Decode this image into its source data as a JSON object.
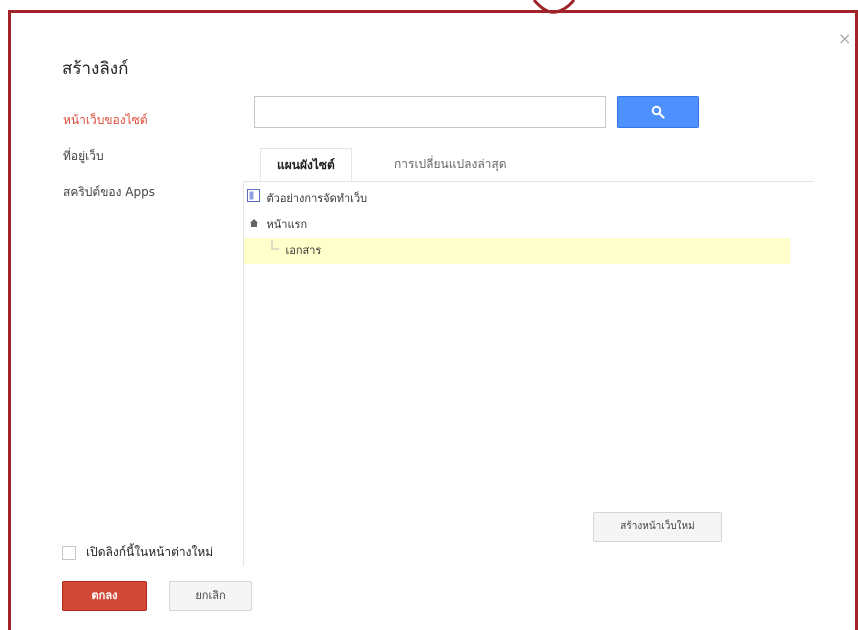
{
  "dialog": {
    "title": "สร้างลิงก์",
    "close_glyph": "×"
  },
  "sidebar": {
    "items": [
      {
        "label": "หน้าเว็บของไซต์",
        "active": true
      },
      {
        "label": "ที่อยู่เว็บ",
        "active": false
      },
      {
        "label": "สคริปต์ของ Apps",
        "active": false
      }
    ]
  },
  "search": {
    "value": "",
    "placeholder": "",
    "button_icon": "search-icon"
  },
  "tabs": [
    {
      "label": "แผนผังไซต์",
      "active": true
    },
    {
      "label": "การเปลี่ยนแปลงล่าสุด",
      "active": false
    }
  ],
  "tree": {
    "root_label": "ตัวอย่างการจัดทำเว็บ",
    "home_label": "หน้าแรก",
    "child_label": "เอกสาร"
  },
  "buttons": {
    "create_page": "สร้างหน้าเว็บใหม่",
    "ok": "ตกลง",
    "cancel": "ยกเลิก"
  },
  "options": {
    "open_new_window_label": "เปิดลิงก์นี้ในหน้าต่างใหม่",
    "open_new_window_checked": false
  },
  "colors": {
    "frame": "#a0232a",
    "active_nav": "#dd4b39",
    "search_button": "#4d90fe",
    "ok_button": "#d14836",
    "selected_row": "#ffffcc"
  }
}
